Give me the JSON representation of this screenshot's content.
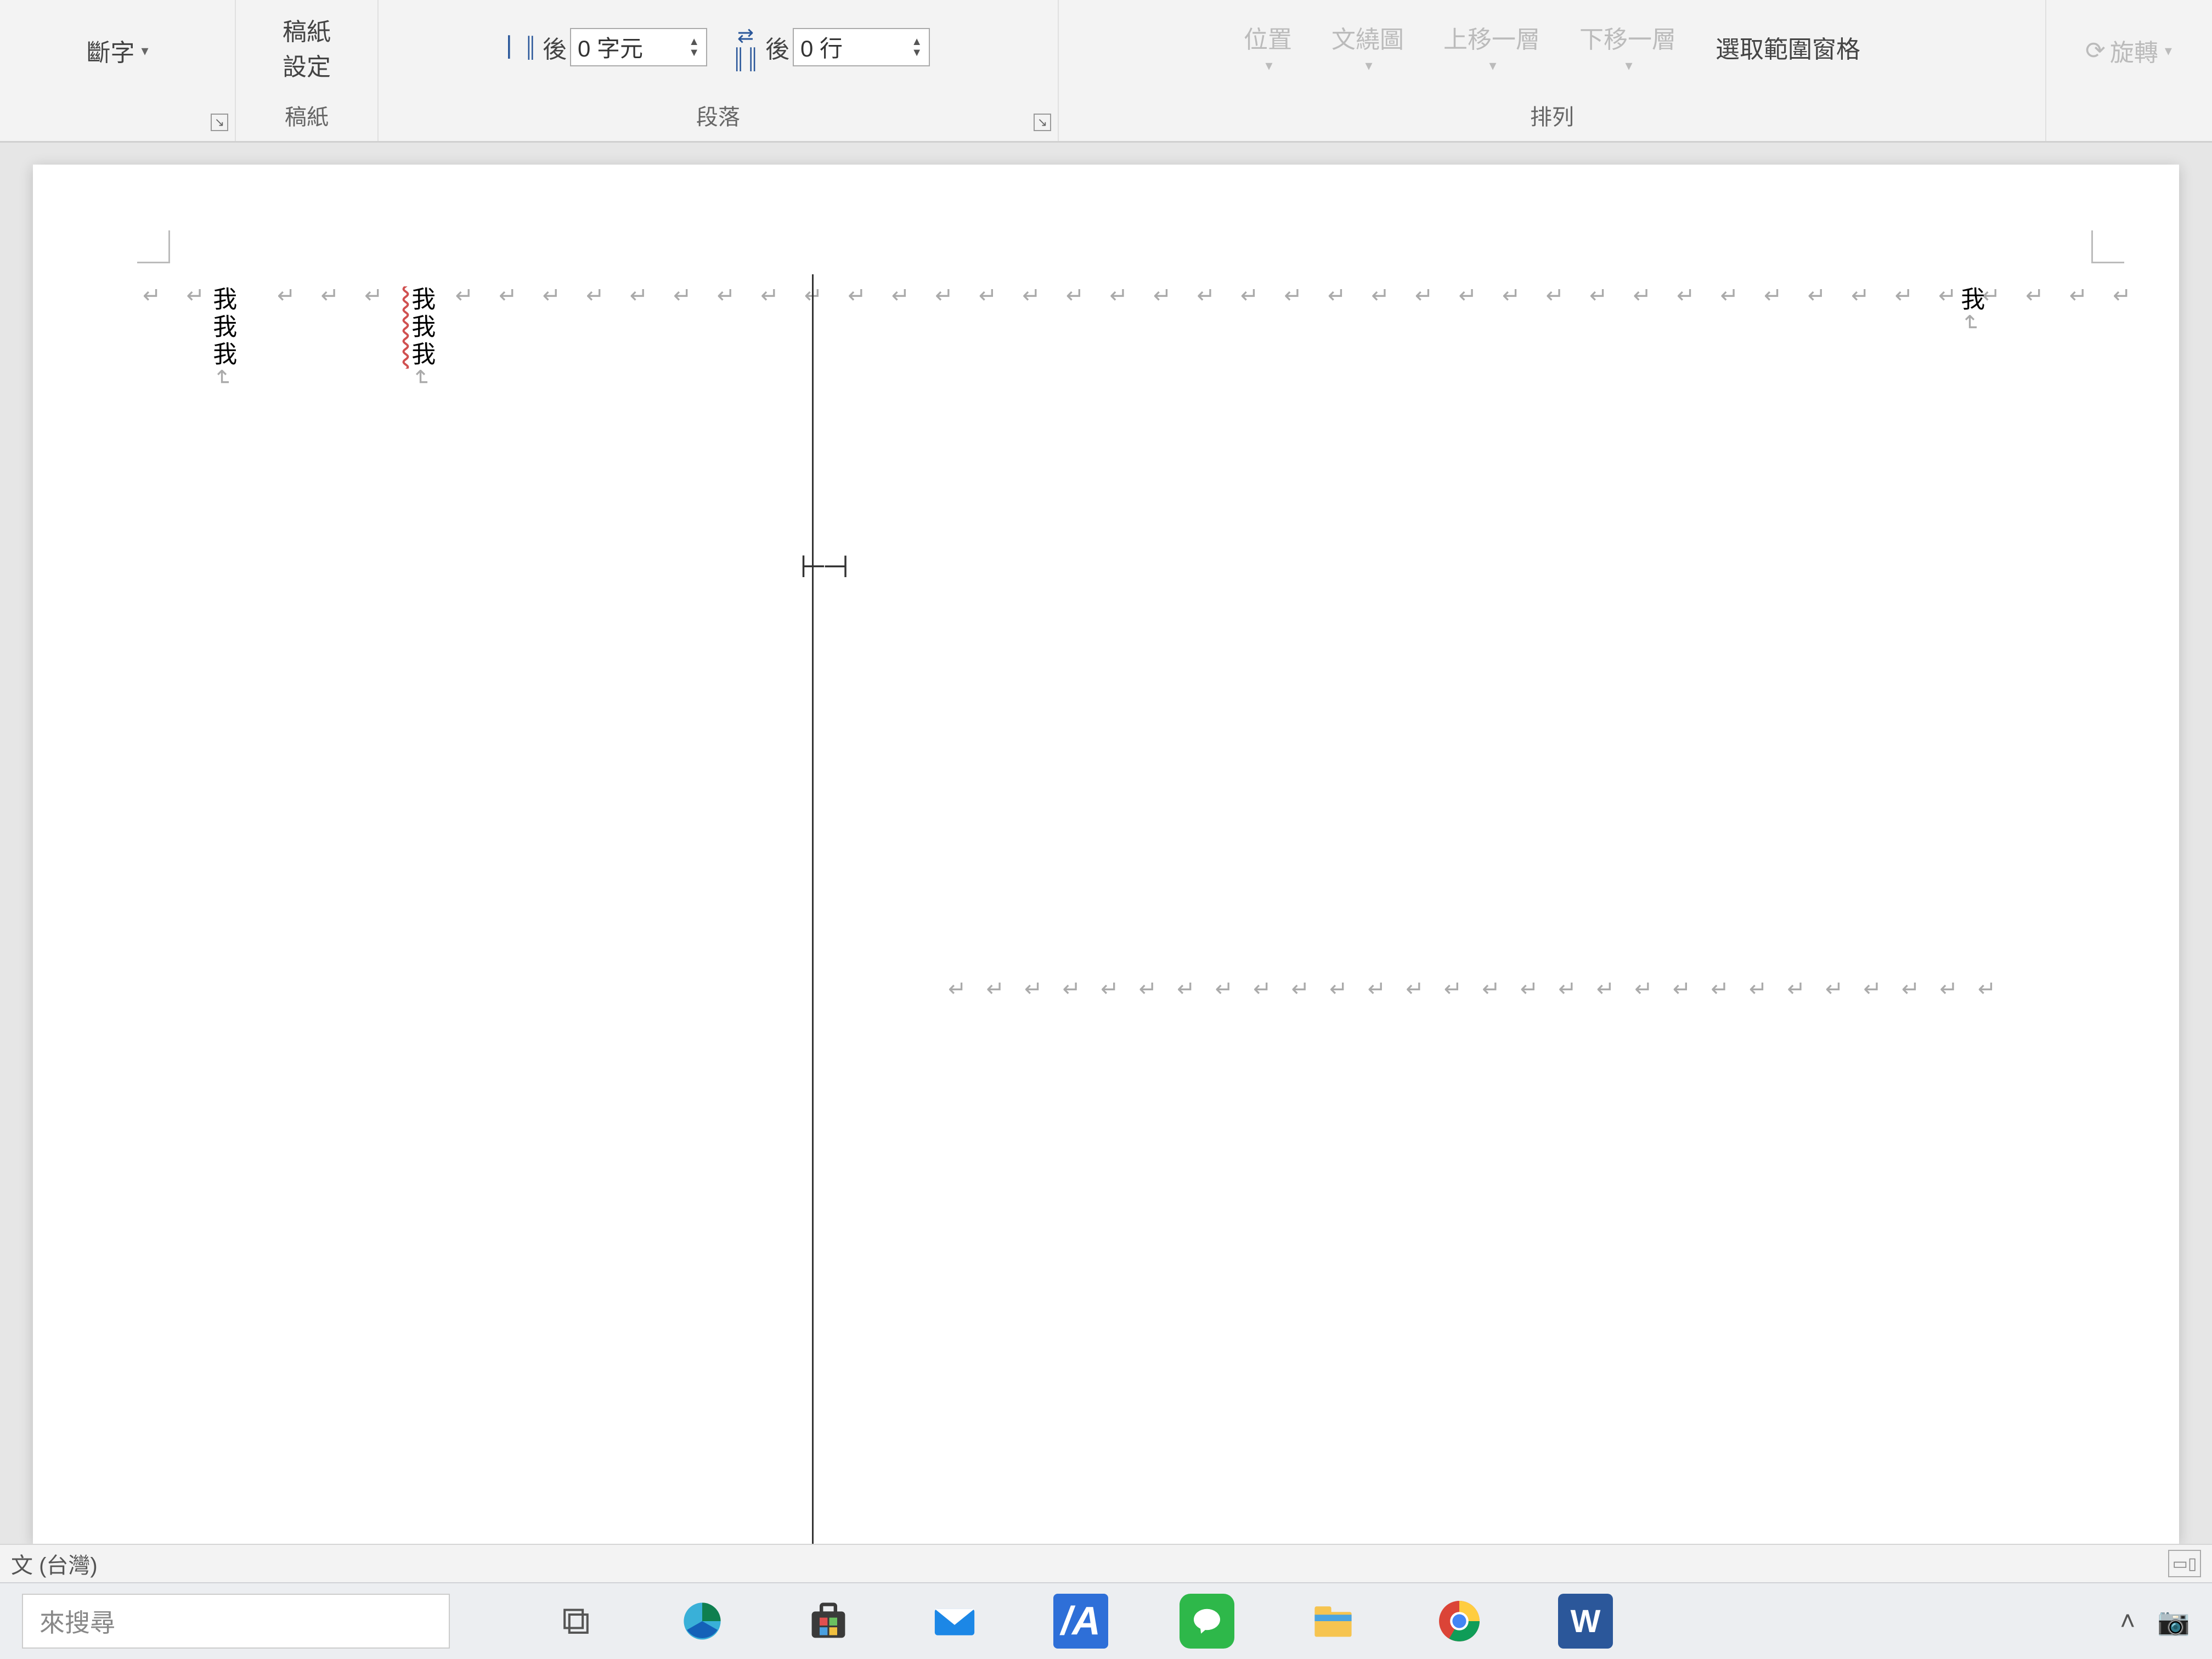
{
  "ribbon": {
    "hyphenation_label": "斷字",
    "manuscript_settings_label": "稿紙\n設定",
    "group_manuscript_label": "稿紙",
    "indent_after_label": "後",
    "indent_after_value": "0 字元",
    "spacing_after_label": "後",
    "spacing_after_value": "0 行",
    "group_paragraph_label": "段落",
    "arrange": {
      "position": "位置",
      "wrap": "文繞圖",
      "forward": "上移一層",
      "backward": "下移一層",
      "selection_pane": "選取範圍窗格",
      "rotate": "旋轉",
      "group_label": "排列"
    }
  },
  "document": {
    "col1_text": "我我我",
    "col2_text": "我我我",
    "col3_text": "我",
    "para_mark": "↵"
  },
  "statusbar": {
    "language": "文 (台灣)"
  },
  "taskbar": {
    "search_placeholder": "來搜尋"
  }
}
